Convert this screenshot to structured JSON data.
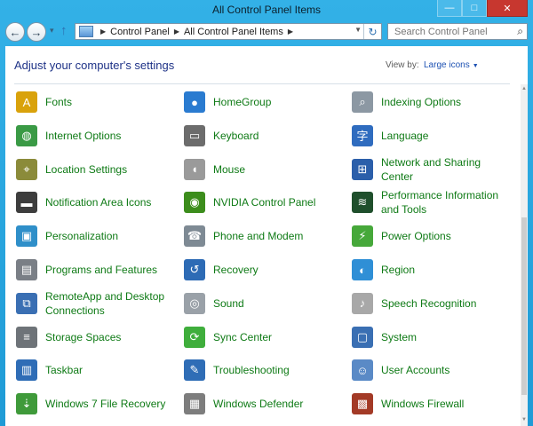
{
  "window": {
    "title": "All Control Panel Items"
  },
  "caption": {
    "minimize": "—",
    "maximize": "□",
    "close": "✕"
  },
  "nav": {
    "back": "←",
    "forward": "→",
    "dropdown": "▾",
    "up": "↑",
    "breadcrumb": [
      "Control Panel",
      "All Control Panel Items"
    ],
    "refresh": "↻",
    "search_placeholder": "Search Control Panel"
  },
  "header": {
    "heading": "Adjust your computer's settings",
    "view_by_label": "View by:",
    "view_by_value": "Large icons"
  },
  "items": [
    {
      "label": "Fonts",
      "icon": "fonts-icon",
      "color": "#d9a20b",
      "glyph": "A"
    },
    {
      "label": "HomeGroup",
      "icon": "homegroup-icon",
      "color": "#2a7bd0",
      "glyph": "●"
    },
    {
      "label": "Indexing Options",
      "icon": "indexing-options-icon",
      "color": "#8c98a3",
      "glyph": "⌕"
    },
    {
      "label": "Internet Options",
      "icon": "internet-options-icon",
      "color": "#3a9a45",
      "glyph": "◍"
    },
    {
      "label": "Keyboard",
      "icon": "keyboard-icon",
      "color": "#6c6c6c",
      "glyph": "▭"
    },
    {
      "label": "Language",
      "icon": "language-icon",
      "color": "#2f6cbf",
      "glyph": "字"
    },
    {
      "label": "Location Settings",
      "icon": "location-settings-icon",
      "color": "#8b8b3a",
      "glyph": "⌖"
    },
    {
      "label": "Mouse",
      "icon": "mouse-icon",
      "color": "#9a9a9a",
      "glyph": "◖"
    },
    {
      "label": "Network and Sharing Center",
      "icon": "network-sharing-icon",
      "color": "#2b5faa",
      "glyph": "⊞"
    },
    {
      "label": "Notification Area Icons",
      "icon": "notification-area-icon",
      "color": "#3d3d3d",
      "glyph": "▬"
    },
    {
      "label": "NVIDIA Control Panel",
      "icon": "nvidia-icon",
      "color": "#3c8d1c",
      "glyph": "◉"
    },
    {
      "label": "Performance Information and Tools",
      "icon": "performance-icon",
      "color": "#1f4f2c",
      "glyph": "≋"
    },
    {
      "label": "Personalization",
      "icon": "personalization-icon",
      "color": "#2f8fc9",
      "glyph": "▣"
    },
    {
      "label": "Phone and Modem",
      "icon": "phone-modem-icon",
      "color": "#7e8a94",
      "glyph": "☎"
    },
    {
      "label": "Power Options",
      "icon": "power-options-icon",
      "color": "#46a83a",
      "glyph": "⚡"
    },
    {
      "label": "Programs and Features",
      "icon": "programs-features-icon",
      "color": "#7a7f86",
      "glyph": "▤"
    },
    {
      "label": "Recovery",
      "icon": "recovery-icon",
      "color": "#2d6bb5",
      "glyph": "↺"
    },
    {
      "label": "Region",
      "icon": "region-icon",
      "color": "#2f8fd6",
      "glyph": "◐"
    },
    {
      "label": "RemoteApp and Desktop Connections",
      "icon": "remoteapp-icon",
      "color": "#3a6fb3",
      "glyph": "⧉"
    },
    {
      "label": "Sound",
      "icon": "sound-icon",
      "color": "#9aa1a8",
      "glyph": "◎"
    },
    {
      "label": "Speech Recognition",
      "icon": "speech-recognition-icon",
      "color": "#a8a8a8",
      "glyph": "♪"
    },
    {
      "label": "Storage Spaces",
      "icon": "storage-spaces-icon",
      "color": "#6e7378",
      "glyph": "≡"
    },
    {
      "label": "Sync Center",
      "icon": "sync-center-icon",
      "color": "#3fae3c",
      "glyph": "⟳"
    },
    {
      "label": "System",
      "icon": "system-icon",
      "color": "#3a6fb3",
      "glyph": "▢"
    },
    {
      "label": "Taskbar",
      "icon": "taskbar-icon",
      "color": "#2f6db6",
      "glyph": "▥"
    },
    {
      "label": "Troubleshooting",
      "icon": "troubleshooting-icon",
      "color": "#2f6db6",
      "glyph": "✎"
    },
    {
      "label": "User Accounts",
      "icon": "user-accounts-icon",
      "color": "#5a8ac6",
      "glyph": "☺"
    },
    {
      "label": "Windows 7 File Recovery",
      "icon": "file-recovery-icon",
      "color": "#3f9a3a",
      "glyph": "⇣"
    },
    {
      "label": "Windows Defender",
      "icon": "windows-defender-icon",
      "color": "#7d7d7d",
      "glyph": "▦"
    },
    {
      "label": "Windows Firewall",
      "icon": "windows-firewall-icon",
      "color": "#a33a26",
      "glyph": "▩"
    }
  ]
}
